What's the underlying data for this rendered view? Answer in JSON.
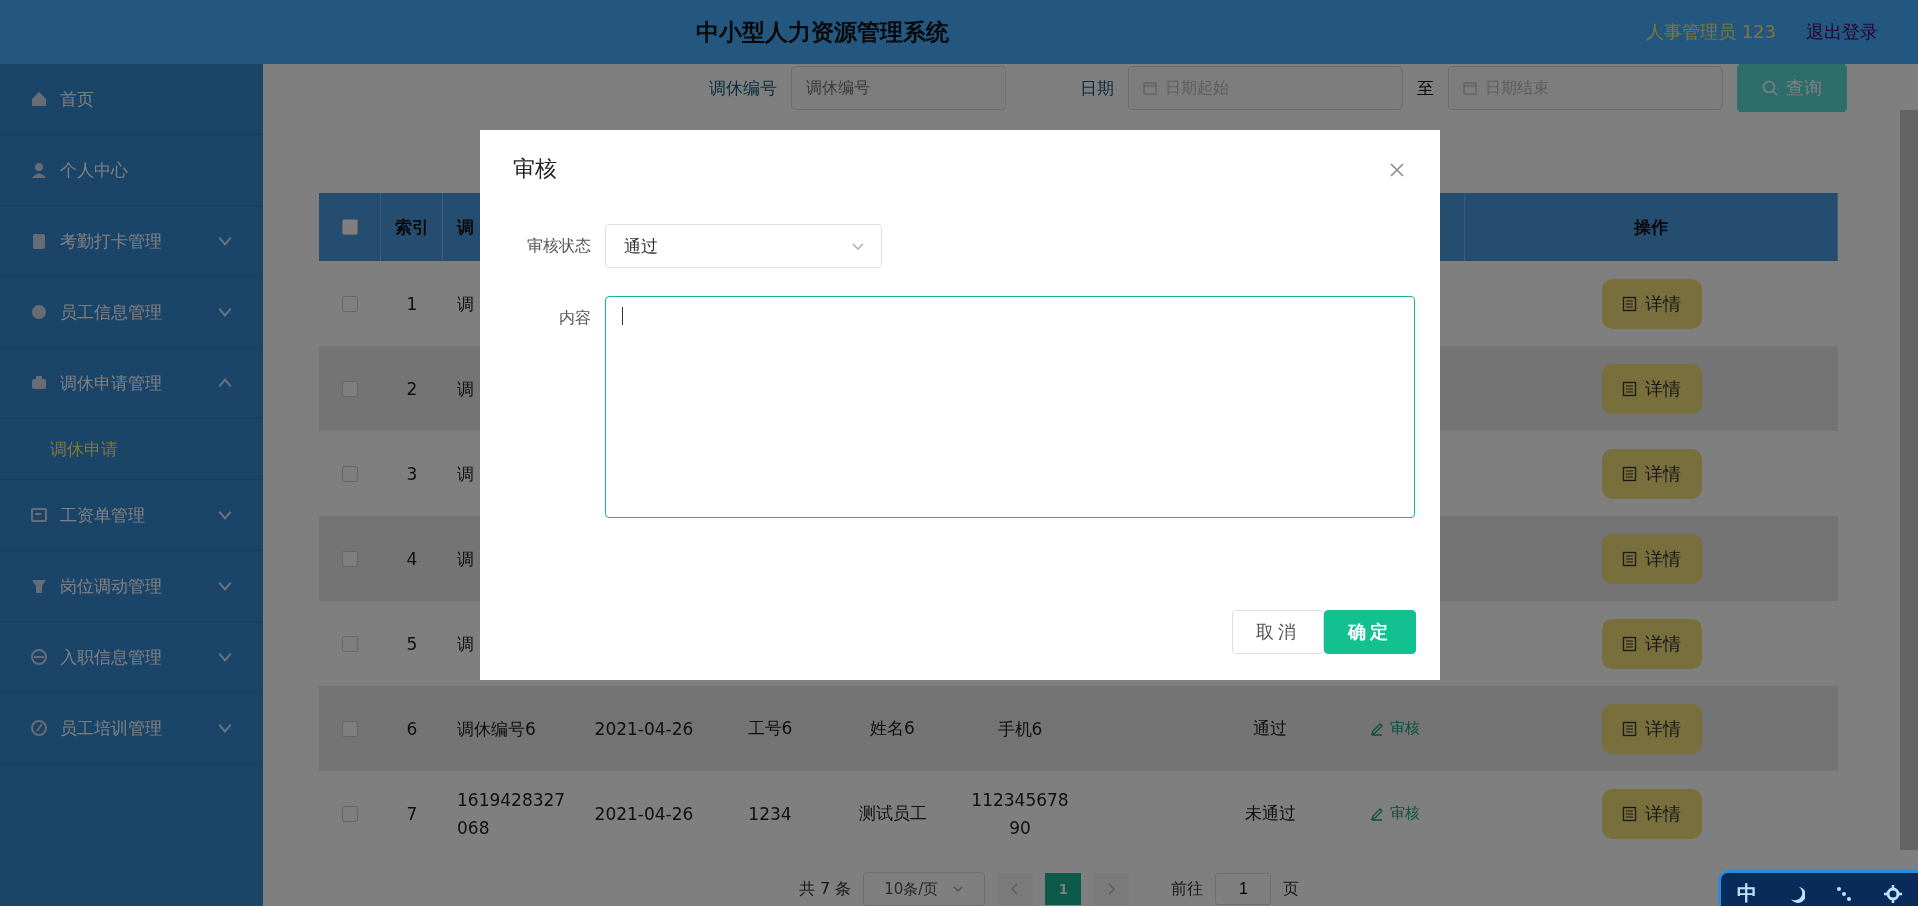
{
  "header": {
    "title": "中小型人力资源管理系统",
    "user": "人事管理员 123",
    "logout": "退出登录"
  },
  "sidebar": {
    "items": [
      {
        "label": "首页",
        "kind": "link"
      },
      {
        "label": "个人中心",
        "kind": "link"
      },
      {
        "label": "考勤打卡管理",
        "kind": "menu",
        "expanded": false
      },
      {
        "label": "员工信息管理",
        "kind": "menu",
        "expanded": false
      },
      {
        "label": "调休申请管理",
        "kind": "menu",
        "expanded": true,
        "children": [
          {
            "label": "调休申请",
            "selected": true
          }
        ]
      },
      {
        "label": "工资单管理",
        "kind": "menu",
        "expanded": false
      },
      {
        "label": "岗位调动管理",
        "kind": "menu",
        "expanded": false
      },
      {
        "label": "入职信息管理",
        "kind": "menu",
        "expanded": false
      },
      {
        "label": "员工培训管理",
        "kind": "menu",
        "expanded": false
      }
    ]
  },
  "search": {
    "code_label": "调休编号",
    "code_placeholder": "调休编号",
    "date_label": "日期",
    "start_placeholder": "日期起始",
    "separator": "至",
    "end_placeholder": "日期结束",
    "button": "查询"
  },
  "table": {
    "select_all": {
      "checked": false
    },
    "index_heading": "索引",
    "column_3_heading": "调",
    "actions_heading": "操作",
    "rows": [
      {
        "checked": false,
        "index": "1",
        "code": "调",
        "detail": "详情"
      },
      {
        "checked": false,
        "index": "2",
        "code": "调",
        "detail": "详情"
      },
      {
        "checked": false,
        "index": "3",
        "code": "调",
        "detail": "详情"
      },
      {
        "checked": false,
        "index": "4",
        "code": "调",
        "detail": "详情"
      },
      {
        "checked": false,
        "index": "5",
        "code": "调",
        "detail": "详情"
      },
      {
        "checked": false,
        "index": "6",
        "code": "调休编号6",
        "date": "2021-04-26",
        "employee_no": "工号6",
        "name": "姓名6",
        "phone": "手机6",
        "status": "通过",
        "review": "审核",
        "detail": "详情"
      },
      {
        "checked": false,
        "index": "7",
        "code": "1619428327068",
        "date": "2021-04-26",
        "employee_no": "1234",
        "name": "测试员工",
        "phone": "11234567890",
        "status": "未通过",
        "review": "审核",
        "detail": "详情"
      }
    ]
  },
  "pagination": {
    "total": "共 7 条",
    "page_size": "10条/页",
    "pages": [
      {
        "label": "1",
        "selected": true
      }
    ],
    "goto_label": "前往",
    "goto_value": "1",
    "page_suffix": "页"
  },
  "dialog": {
    "title": "审核",
    "fields": [
      {
        "kind": "select",
        "label": "审核状态",
        "value": "通过"
      },
      {
        "kind": "textarea",
        "label": "内容",
        "focused": true
      }
    ],
    "buttons": [
      {
        "label": "取消",
        "kind": "secondary"
      },
      {
        "label": "确定",
        "kind": "primary"
      }
    ]
  },
  "ime_toolbar": {
    "mode": "中"
  }
}
